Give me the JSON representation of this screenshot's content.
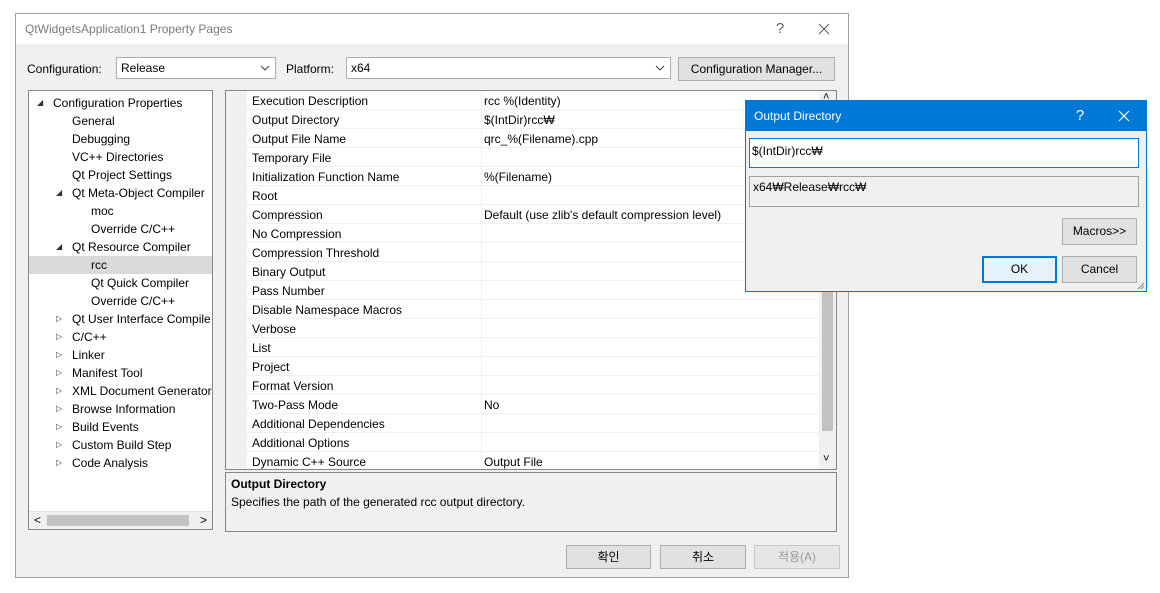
{
  "main_window": {
    "title": "QtWidgetsApplication1 Property Pages",
    "help_glyph": "?",
    "close_glyph": "✕"
  },
  "config_bar": {
    "configuration_label": "Configuration:",
    "configuration_value": "Release",
    "platform_label": "Platform:",
    "platform_value": "x64",
    "config_manager_label": "Configuration Manager..."
  },
  "tree": {
    "items": [
      {
        "label": "Configuration Properties",
        "arrow": "◢"
      },
      {
        "label": "General",
        "arrow": ""
      },
      {
        "label": "Debugging",
        "arrow": ""
      },
      {
        "label": "VC++ Directories",
        "arrow": ""
      },
      {
        "label": "Qt Project Settings",
        "arrow": ""
      },
      {
        "label": "Qt Meta-Object Compiler",
        "arrow": "◢"
      },
      {
        "label": "moc",
        "arrow": ""
      },
      {
        "label": "Override C/C++",
        "arrow": ""
      },
      {
        "label": "Qt Resource Compiler",
        "arrow": "◢"
      },
      {
        "label": "rcc",
        "arrow": "",
        "selected": true
      },
      {
        "label": "Qt Quick Compiler",
        "arrow": ""
      },
      {
        "label": "Override C/C++",
        "arrow": ""
      },
      {
        "label": "Qt User Interface Compile",
        "arrow": "▷"
      },
      {
        "label": "C/C++",
        "arrow": "▷"
      },
      {
        "label": "Linker",
        "arrow": "▷"
      },
      {
        "label": "Manifest Tool",
        "arrow": "▷"
      },
      {
        "label": "XML Document Generator",
        "arrow": "▷"
      },
      {
        "label": "Browse Information",
        "arrow": "▷"
      },
      {
        "label": "Build Events",
        "arrow": "▷"
      },
      {
        "label": "Custom Build Step",
        "arrow": "▷"
      },
      {
        "label": "Code Analysis",
        "arrow": "▷"
      }
    ],
    "scroll_left": "<",
    "scroll_right": ">"
  },
  "grid": {
    "rows": [
      {
        "name": "Execution Description",
        "value": "rcc %(Identity)"
      },
      {
        "name": "Output Directory",
        "value": "$(IntDir)rcc₩"
      },
      {
        "name": "Output File Name",
        "value": "qrc_%(Filename).cpp"
      },
      {
        "name": "Temporary File",
        "value": ""
      },
      {
        "name": "Initialization Function Name",
        "value": "%(Filename)"
      },
      {
        "name": "Root",
        "value": ""
      },
      {
        "name": "Compression",
        "value": "Default (use zlib's default compression level)"
      },
      {
        "name": "No Compression",
        "value": ""
      },
      {
        "name": "Compression Threshold",
        "value": ""
      },
      {
        "name": "Binary Output",
        "value": ""
      },
      {
        "name": "Pass Number",
        "value": ""
      },
      {
        "name": "Disable Namespace Macros",
        "value": ""
      },
      {
        "name": "Verbose",
        "value": ""
      },
      {
        "name": "List",
        "value": ""
      },
      {
        "name": "Project",
        "value": ""
      },
      {
        "name": "Format Version",
        "value": ""
      },
      {
        "name": "Two-Pass Mode",
        "value": "No"
      },
      {
        "name": "Additional Dependencies",
        "value": ""
      },
      {
        "name": "Additional Options",
        "value": ""
      },
      {
        "name": "Dynamic C++ Source",
        "value": "Output File"
      }
    ],
    "scroll_up": "˄",
    "scroll_down": "˅"
  },
  "description": {
    "title": "Output Directory",
    "text": "Specifies the path of the generated rcc output directory."
  },
  "footer": {
    "ok_label": "확인",
    "cancel_label": "취소",
    "apply_label": "적용(A)"
  },
  "popup": {
    "title": "Output Directory",
    "help_glyph": "?",
    "close_glyph": "✕",
    "edit_value": "$(IntDir)rcc₩",
    "evaluated_value": "x64₩Release₩rcc₩",
    "macros_label": "Macros>>",
    "ok_label": "OK",
    "cancel_label": "Cancel"
  },
  "colors": {
    "accent": "#0078d7",
    "window_bg": "#f0f0f0",
    "selection": "#d9d9d9"
  }
}
